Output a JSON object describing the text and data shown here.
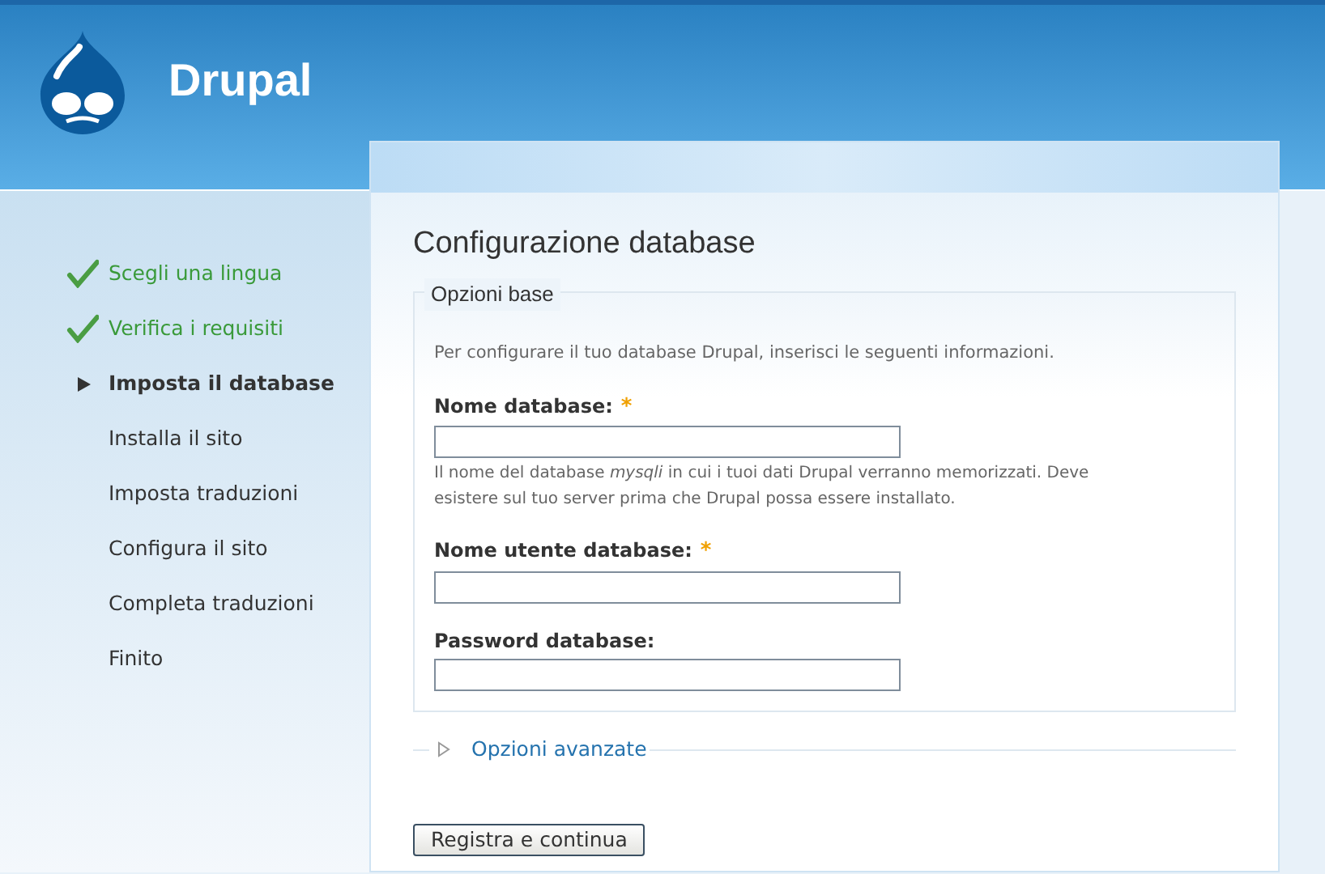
{
  "site": {
    "name": "Drupal"
  },
  "steps": [
    {
      "label": "Scegli una lingua",
      "kind": "done"
    },
    {
      "label": "Verifica i requisiti",
      "kind": "done"
    },
    {
      "label": "Imposta il database",
      "kind": "active"
    },
    {
      "label": "Installa il sito",
      "kind": "pending"
    },
    {
      "label": "Imposta traduzioni",
      "kind": "pending"
    },
    {
      "label": "Configura il sito",
      "kind": "pending"
    },
    {
      "label": "Completa traduzioni",
      "kind": "pending"
    },
    {
      "label": "Finito",
      "kind": "pending"
    }
  ],
  "page_title": "Configurazione database",
  "basic": {
    "legend": "Opzioni base",
    "intro": "Per configurare il tuo database Drupal, inserisci le seguenti informazioni.",
    "fields": [
      {
        "label": "Nome database:",
        "required_mark": "*",
        "hint": "Il nome del database *mysqli* in cui i tuoi dati Drupal verranno memorizzati. Deve esistere sul tuo server prima che Drupal possa essere installato."
      },
      {
        "label": "Nome utente database:",
        "required_mark": "*"
      },
      {
        "label": "Password database:"
      }
    ]
  },
  "advanced": {
    "legend": "Opzioni avanzate",
    "expanded": false
  },
  "submit": "Registra e continua"
}
